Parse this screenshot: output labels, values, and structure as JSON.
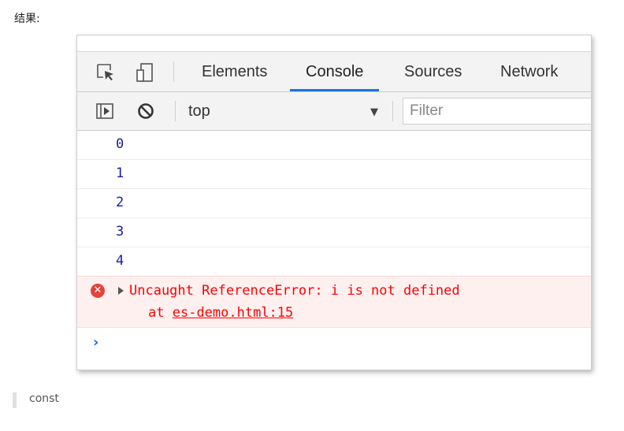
{
  "page": {
    "result_label": "结果:",
    "quote_text": "const"
  },
  "devtools": {
    "tabs": [
      {
        "label": "Elements",
        "active": false
      },
      {
        "label": "Console",
        "active": true
      },
      {
        "label": "Sources",
        "active": false
      },
      {
        "label": "Network",
        "active": false
      }
    ],
    "toolbar": {
      "context": "top",
      "filter_placeholder": "Filter",
      "icons": [
        "inspect-element-icon",
        "device-toolbar-icon",
        "sidebar-toggle-icon",
        "clear-console-icon",
        "context-dropdown-arrow-icon"
      ]
    },
    "accent_color": "#1a73e8",
    "console": {
      "logs": [
        "0",
        "1",
        "2",
        "3",
        "4"
      ],
      "error": {
        "message": "Uncaught ReferenceError: i is not defined",
        "at_prefix": "at",
        "location": "es-demo.html:15"
      },
      "prompt_symbol": "›"
    }
  }
}
